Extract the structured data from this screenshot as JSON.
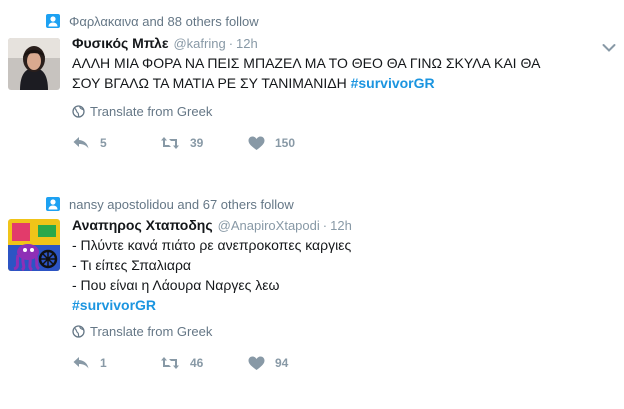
{
  "tweets": [
    {
      "context": "Φαρλακαινα and 88 others follow",
      "name": "Φυσικός Μπλε",
      "handle": "@kafring",
      "dot": "·",
      "time": "12h",
      "lines": [
        "ΑΛΛΗ ΜΙΑ ΦΟΡΑ ΝΑ ΠΕΙΣ ΜΠΑΖΕΛ ΜΑ ΤΟ ΘΕΟ ΘΑ ΓΙΝΩ ΣΚΥΛΑ ΚΑΙ ΘΑ",
        "ΣΟΥ ΒΓΑΛΩ ΤΑ ΜΑΤΙΑ ΡΕ ΣΥ ΤΑΝΙΜΑΝΙΔΗ"
      ],
      "hashtag": "#survivorGR",
      "translate": "Translate from Greek",
      "replies": "5",
      "retweets": "39",
      "likes": "150"
    },
    {
      "context": "nansy apostolidou and 67 others follow",
      "name": "Αναπηρος Χταποδης",
      "handle": "@AnapiroXtapodi",
      "dot": "·",
      "time": "12h",
      "lines": [
        "- Πλύντε κανά πιάτο ρε ανεπροκοπες καργιες",
        "- Τι είπες Σπαλιαρα",
        "- Που είναι η Λάουρα Ναργες λεω"
      ],
      "hashtag": "#survivorGR",
      "translate": "Translate from Greek",
      "replies": "1",
      "retweets": "46",
      "likes": "94"
    }
  ],
  "colors": {
    "accent": "#1da1f2",
    "hashtag": "#1b95e0",
    "muted": "#8899a6",
    "text": "#14171a"
  },
  "icons": {
    "context": "person-icon",
    "caret": "chevron-down-icon",
    "translate": "globe-icon",
    "reply": "reply-icon",
    "retweet": "retweet-icon",
    "like": "heart-icon"
  }
}
